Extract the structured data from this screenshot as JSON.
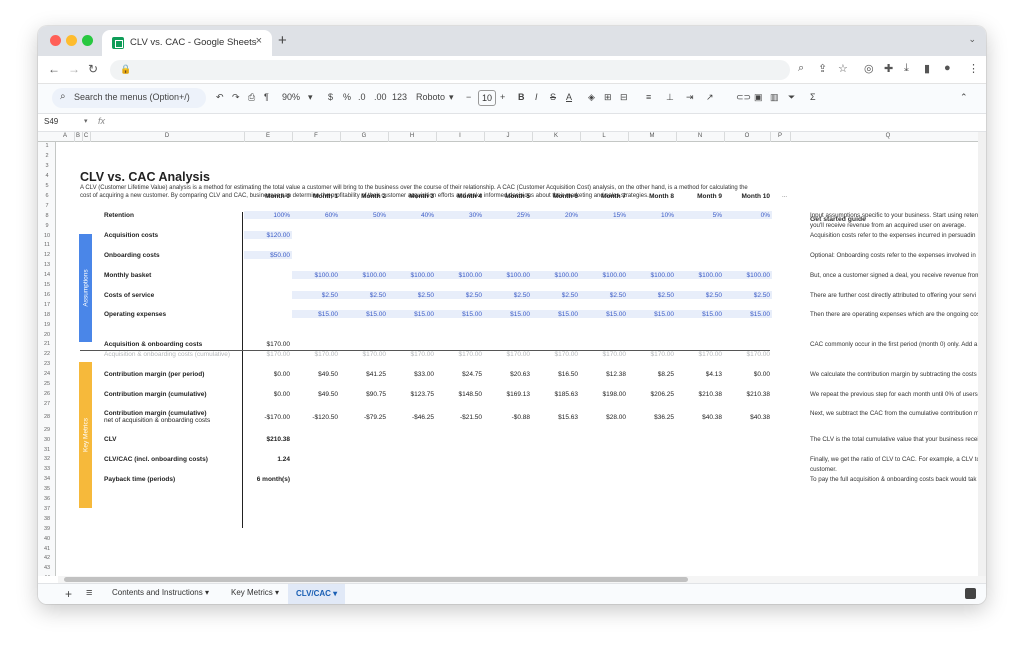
{
  "browser": {
    "tab_title": "CLV vs. CAC - Google Sheets",
    "tab_close": "×",
    "new_tab": "+"
  },
  "toolbar": {
    "search_menus": "Search the menus (Option+/)",
    "zoom": "90%",
    "currency": "$",
    "percent": "%",
    "dec_less": ".0",
    "dec_more": ".00",
    "format_123": "123",
    "font": "Roboto",
    "font_size": "10",
    "minus": "−",
    "plus": "+",
    "bold": "B",
    "italic": "I",
    "strike": "S",
    "text_color": "A",
    "sigma": "Σ"
  },
  "formula_bar": {
    "cell_ref": "S49",
    "fx": "fx"
  },
  "columns": [
    "A",
    "B",
    "C",
    "D",
    "E",
    "F",
    "G",
    "H",
    "I",
    "J",
    "K",
    "L",
    "M",
    "N",
    "O",
    "P",
    "Q"
  ],
  "rows": [
    "1",
    "2",
    "3",
    "4",
    "5",
    "6",
    "7",
    "8",
    "9",
    "10",
    "11",
    "12",
    "13",
    "14",
    "15",
    "16",
    "17",
    "18",
    "19",
    "20",
    "21",
    "22",
    "23",
    "24",
    "25",
    "26",
    "27",
    "28",
    "29",
    "30",
    "31",
    "32",
    "33",
    "34",
    "35",
    "36",
    "37",
    "38",
    "39",
    "40",
    "41",
    "42",
    "43",
    "44"
  ],
  "sheet": {
    "title": "CLV vs. CAC Analysis",
    "description": "A CLV (Customer Lifetime Value) analysis is a method for estimating the total value a customer will bring to the business over the course of their relationship. A CAC (Customer Acquisition Cost) analysis, on the other hand, is a method for calculating the cost of acquiring a new customer. By comparing CLV and CAC, businesses can determine the profitability of their customer acquisition efforts and make informed decisions about their marketing and sales strategies.",
    "months": [
      "Month 0",
      "Month 1",
      "Month 2",
      "Month 3",
      "Month 4",
      "Month 5",
      "Month 6",
      "Month 7",
      "Month 8",
      "Month 9",
      "Month 10"
    ],
    "more_cols": "...",
    "assumptions_label": "Assumptions",
    "key_metrics_label": "Key Metrics",
    "assumptions": [
      {
        "label": "Retention",
        "values": [
          "100%",
          "60%",
          "50%",
          "40%",
          "30%",
          "25%",
          "20%",
          "15%",
          "10%",
          "5%",
          "0%"
        ]
      },
      {
        "label": "Acquisition costs",
        "values": [
          "$120.00",
          "",
          "",
          "",
          "",
          "",
          "",
          "",
          "",
          "",
          ""
        ]
      },
      {
        "label": "Onboarding costs",
        "values": [
          "$50.00",
          "",
          "",
          "",
          "",
          "",
          "",
          "",
          "",
          "",
          ""
        ]
      },
      {
        "label": "Monthly basket",
        "values": [
          "",
          "$100.00",
          "$100.00",
          "$100.00",
          "$100.00",
          "$100.00",
          "$100.00",
          "$100.00",
          "$100.00",
          "$100.00",
          "$100.00"
        ]
      },
      {
        "label": "Costs of service",
        "values": [
          "",
          "$2.50",
          "$2.50",
          "$2.50",
          "$2.50",
          "$2.50",
          "$2.50",
          "$2.50",
          "$2.50",
          "$2.50",
          "$2.50"
        ]
      },
      {
        "label": "Operating expenses",
        "values": [
          "",
          "$15.00",
          "$15.00",
          "$15.00",
          "$15.00",
          "$15.00",
          "$15.00",
          "$15.00",
          "$15.00",
          "$15.00",
          "$15.00"
        ]
      }
    ],
    "metrics": {
      "acq_onb": {
        "label": "Acquisition & onboarding costs",
        "values": [
          "$170.00",
          "",
          "",
          "",
          "",
          "",
          "",
          "",
          "",
          "",
          ""
        ]
      },
      "acq_onb_cum": {
        "label": "Acquisition & onboarding costs (cumulative)",
        "values": [
          "$170.00",
          "$170.00",
          "$170.00",
          "$170.00",
          "$170.00",
          "$170.00",
          "$170.00",
          "$170.00",
          "$170.00",
          "$170.00",
          "$170.00"
        ]
      },
      "cm_period": {
        "label": "Contribution margin (per period)",
        "values": [
          "$0.00",
          "$49.50",
          "$41.25",
          "$33.00",
          "$24.75",
          "$20.63",
          "$16.50",
          "$12.38",
          "$8.25",
          "$4.13",
          "$0.00"
        ]
      },
      "cm_cum": {
        "label": "Contribution margin (cumulative)",
        "values": [
          "$0.00",
          "$49.50",
          "$90.75",
          "$123.75",
          "$148.50",
          "$169.13",
          "$185.63",
          "$198.00",
          "$206.25",
          "$210.38",
          "$210.38"
        ]
      },
      "cm_net_label1": "Contribution margin (cumulative)",
      "cm_net_label2": "net of acquisition & onboarding costs",
      "cm_net_values": [
        "-$170.00",
        "-$120.50",
        "-$79.25",
        "-$46.25",
        "-$21.50",
        "-$0.88",
        "$15.63",
        "$28.00",
        "$36.25",
        "$40.38",
        "$40.38"
      ],
      "clv": {
        "label": "CLV",
        "value": "$210.38"
      },
      "ratio": {
        "label": "CLV/CAC (incl. onboarding costs)",
        "value": "1.24"
      },
      "payback": {
        "label": "Payback time (periods)",
        "value": "6 month(s)"
      }
    },
    "guide": {
      "heading": "Get started guide",
      "lines": [
        "Input assumptions specific to your business. Start using reten",
        "you'll receive revenue from an acquired user on average.",
        "Acquisition costs refer to the expenses incurred in persuadin",
        "Optional: Onboarding costs refer to the expenses involved in",
        "But, once a customer signed a deal, you receive revenue from",
        "There are further cost directly attributed to offering your servi",
        "Then there are operating expenses which are the ongoing cos",
        "CAC commonly occur in the first period (month 0) only. Add a",
        "We calculate the contribution margin by subtracting the costs",
        "We repeat the previous step for each month until 0% of users",
        "Next, we subtract the CAC from the cumulative contribution m",
        "The CLV is the total cumulative value that your business recei",
        "Finally, we get the ratio of CLV to CAC. For example, a CLV to",
        "customer.",
        "To pay the full acquisition & onboarding costs back would tak"
      ]
    }
  },
  "sheet_tabs": [
    {
      "label": "Contents and Instructions ▾"
    },
    {
      "label": "Key Metrics ▾"
    },
    {
      "label": "CLV/CAC ▾"
    }
  ],
  "colors": {
    "assumptions_bar": "#4a86e8",
    "key_metrics_bar": "#f6b93b",
    "blue_text": "#3b5bc6",
    "band": "#e8eefa"
  }
}
